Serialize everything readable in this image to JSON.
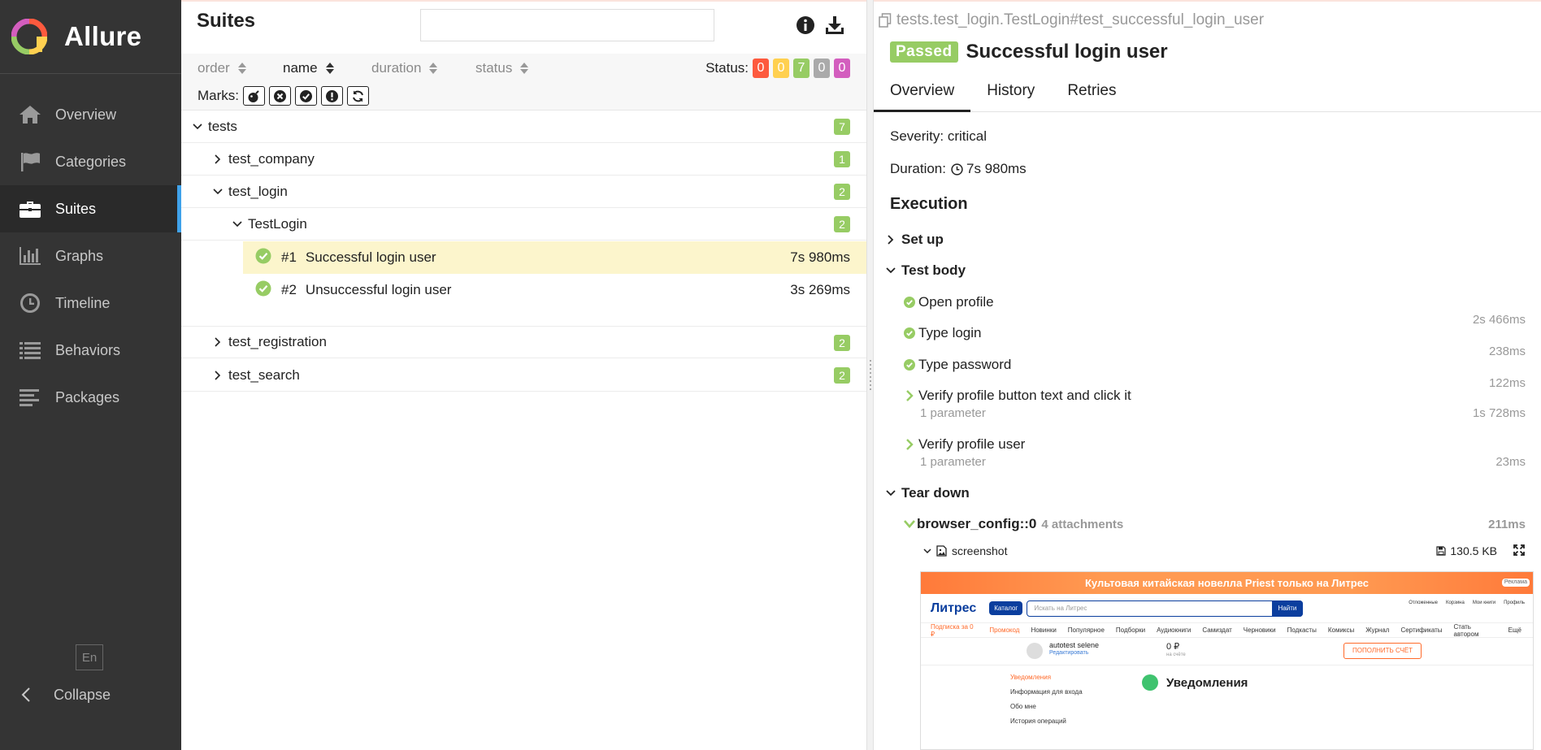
{
  "app": {
    "name": "Allure"
  },
  "sidebar": {
    "items": [
      {
        "label": "Overview",
        "icon": "home-icon"
      },
      {
        "label": "Categories",
        "icon": "flag-icon"
      },
      {
        "label": "Suites",
        "icon": "briefcase-icon"
      },
      {
        "label": "Graphs",
        "icon": "bar-chart-icon"
      },
      {
        "label": "Timeline",
        "icon": "clock-icon"
      },
      {
        "label": "Behaviors",
        "icon": "list-icon"
      },
      {
        "label": "Packages",
        "icon": "align-left-icon"
      }
    ],
    "active": "Suites",
    "lang": "En",
    "collapse_label": "Collapse"
  },
  "suites": {
    "title": "Suites",
    "search_value": "",
    "sort": {
      "order": "order",
      "name": "name",
      "duration": "duration",
      "status": "status",
      "active": "name"
    },
    "status_label": "Status:",
    "status_counts": {
      "failed": "0",
      "broken": "0",
      "passed": "7",
      "skipped": "0",
      "unknown": "0"
    },
    "marks_label": "Marks:",
    "tree": {
      "root": {
        "label": "tests",
        "count": "7"
      },
      "company": {
        "label": "test_company",
        "count": "1"
      },
      "login": {
        "label": "test_login",
        "count": "2"
      },
      "login_class": {
        "label": "TestLogin",
        "count": "2"
      },
      "case1": {
        "num": "#1",
        "label": "Successful login user",
        "duration": "7s 980ms"
      },
      "case2": {
        "num": "#2",
        "label": "Unsuccessful login user",
        "duration": "3s 269ms"
      },
      "registration": {
        "label": "test_registration",
        "count": "2"
      },
      "search": {
        "label": "test_search",
        "count": "2"
      }
    }
  },
  "testcase": {
    "path": "tests.test_login.TestLogin#test_successful_login_user",
    "status": "Passed",
    "title": "Successful login user",
    "tabs": [
      "Overview",
      "History",
      "Retries"
    ],
    "active_tab": "Overview",
    "severity": "Severity: critical",
    "duration_label": "Duration:",
    "duration": "7s 980ms",
    "execution_title": "Execution",
    "setup_label": "Set up",
    "body_label": "Test body",
    "steps": [
      {
        "label": "Open profile",
        "duration": "2s 466ms"
      },
      {
        "label": "Type login",
        "duration": "238ms"
      },
      {
        "label": "Type password",
        "duration": "122ms"
      },
      {
        "label": "Verify profile button text and click it",
        "sub": "1 parameter",
        "duration": "1s 728ms"
      },
      {
        "label": "Verify profile user",
        "sub": "1 parameter",
        "duration": "23ms"
      }
    ],
    "teardown_label": "Tear down",
    "fixture": {
      "name": "browser_config::0",
      "attachments": "4 attachments",
      "duration": "211ms"
    },
    "attachment": {
      "name": "screenshot",
      "size": "130.5 KB"
    }
  },
  "preview": {
    "banner": "Культовая китайская новелла Priest только на Литрес",
    "ad": "Реклама",
    "logo": "Литрес",
    "catalog": "Каталог",
    "search_placeholder": "Искать на Литрес",
    "search_button": "Найти",
    "icons": [
      "Отложенные",
      "Корзина",
      "Мои книги",
      "Профиль"
    ],
    "menu": [
      "Подписка за 0 ₽",
      "Промокод",
      "Новинки",
      "Популярное",
      "Подборки",
      "Аудиокниги",
      "Самиздат",
      "Черновики",
      "Подкасты",
      "Комиксы",
      "Журнал",
      "Сертификаты",
      "Стать автором",
      "Ещё"
    ],
    "user_name": "autotest selene",
    "user_edit": "Редактировать",
    "balance": "0 ₽",
    "balance_sub": "на счёте",
    "topup": "ПОПОЛНИТЬ СЧЁТ",
    "side": [
      "Уведомления",
      "Информация для входа",
      "Обо мне",
      "История операций"
    ],
    "notif_title": "Уведомления"
  }
}
